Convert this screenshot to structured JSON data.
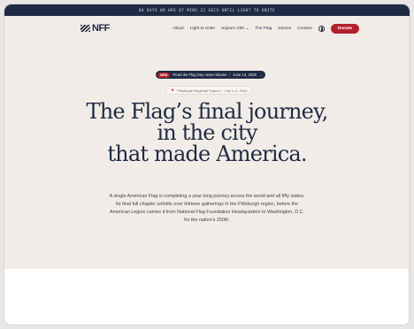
{
  "countdown": "86 DAYS 09 HRS 07 MINS 22 SECS UNTIL LIGHT TO UNITE",
  "brand": {
    "logo_text": "NFF"
  },
  "nav": {
    "items": [
      "About",
      "Light to Unite",
      "Sojourn 250 ⌄",
      "The Flag",
      "Stories",
      "Contact"
    ],
    "donate_label": "Donate"
  },
  "announcement": {
    "tag": "NEW",
    "text": "Read the Flag Day news release",
    "date": "June 14, 2026",
    "arrow": "→"
  },
  "event_badge": {
    "icon": "★",
    "text": "Pittsburgh Regional Sojourn · July 1–4, 2026"
  },
  "headline": {
    "line1": "The Flag’s final journey,",
    "line2": "in the city",
    "line3": "that made America."
  },
  "description": "A single American Flag is completing a year-long journey across the world and all fifty states. Its final full chapter unfolds over thirteen gatherings in the Pittsburgh region, before the American Legion carries it from National Flag Foundation Headquarters to Washington, D.C. for the nation’s 250th.",
  "colors": {
    "navy": "#1f2a44",
    "accent_red": "#b3202d",
    "hero_bg": "#f1ece7"
  }
}
